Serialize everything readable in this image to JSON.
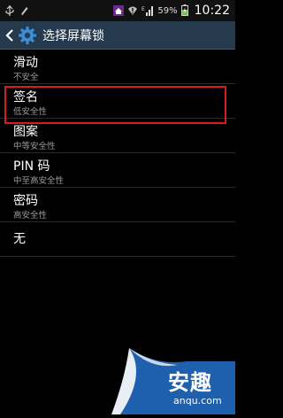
{
  "status_bar": {
    "battery_percent": "59%",
    "time": "10:22"
  },
  "header": {
    "title": "选择屏幕锁"
  },
  "options": [
    {
      "label": "滑动",
      "sub": "不安全"
    },
    {
      "label": "签名",
      "sub": "低安全性"
    },
    {
      "label": "图案",
      "sub": "中等安全性"
    },
    {
      "label": "PIN 码",
      "sub": "中至高安全性"
    },
    {
      "label": "密码",
      "sub": "高安全性"
    },
    {
      "label": "无",
      "sub": ""
    }
  ],
  "highlighted_option": "签名",
  "watermark": {
    "main": "安趣",
    "sub": "anqu.com"
  },
  "colors": {
    "action_bar": "#263a4e",
    "highlight_border": "#d71c1c",
    "background": "#000000"
  }
}
